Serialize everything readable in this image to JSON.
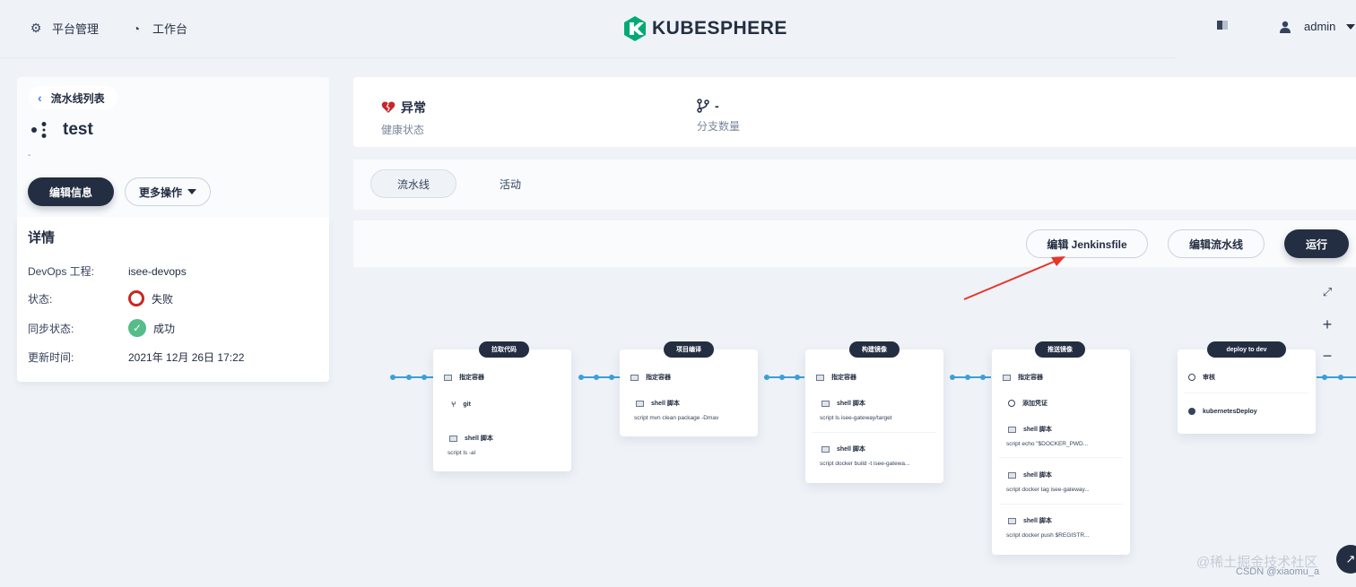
{
  "topbar": {
    "platform_label": "平台管理",
    "workbench_label": "工作台",
    "logo_text": "KUBESPHERE",
    "user": "admin",
    "icons": [
      "gear-icon",
      "dashboard-icon",
      "notebook-icon",
      "user-icon",
      "caret-down-icon"
    ]
  },
  "sidebar": {
    "back_label": "流水线列表",
    "pipeline_name": "test",
    "description": "-",
    "edit_info_label": "编辑信息",
    "more_actions_label": "更多操作",
    "details_title": "详情",
    "details": [
      {
        "label": "DevOps 工程:",
        "value": "isee-devops"
      },
      {
        "label": "状态:",
        "value": "失败"
      },
      {
        "label": "同步状态:",
        "value": "成功"
      },
      {
        "label": "更新时间:",
        "value": "2021年 12月 26日 17:22"
      }
    ]
  },
  "status": {
    "health_value": "异常",
    "health_label": "健康状态",
    "branch_value": "-",
    "branch_label": "分支数量"
  },
  "tabs": [
    {
      "label": "流水线",
      "active": true
    },
    {
      "label": "活动",
      "active": false
    }
  ],
  "toolbar": {
    "edit_jenkinsfile_label": "编辑 Jenkinsfile",
    "edit_pipeline_label": "编辑流水线",
    "run_label": "运行"
  },
  "canvas": {
    "zoom_in": "+",
    "zoom_out": "−",
    "fullscreen_icon": "expand-icon"
  },
  "stages": [
    {
      "name": "拉取代码",
      "steps": [
        {
          "title": "指定容器",
          "icon": "container-icon"
        },
        {
          "title": "git",
          "icon": "git-branch-icon"
        },
        {
          "title": "shell 脚本",
          "icon": "container-icon",
          "sub": "script   ls -al"
        }
      ]
    },
    {
      "name": "项目编译",
      "steps": [
        {
          "title": "指定容器",
          "icon": "container-icon"
        },
        {
          "title": "shell 脚本",
          "icon": "container-icon",
          "sub": "script   mvn clean package -Dmav"
        }
      ]
    },
    {
      "name": "构建镜像",
      "steps": [
        {
          "title": "指定容器",
          "icon": "container-icon"
        },
        {
          "title": "shell 脚本",
          "icon": "container-icon",
          "sub": "script   ls isee-gateway/target"
        },
        {
          "title": "shell 脚本",
          "icon": "container-icon",
          "sub": "script   docker build -t isee-gatewa..."
        }
      ]
    },
    {
      "name": "推送镜像",
      "steps": [
        {
          "title": "指定容器",
          "icon": "container-icon"
        },
        {
          "title": "添加凭证",
          "icon": "key-icon"
        },
        {
          "title": "shell 脚本",
          "icon": "container-icon",
          "sub": "script   echo \"$DOCKER_PWD..."
        },
        {
          "title": "shell 脚本",
          "icon": "container-icon",
          "sub": "script   docker tag isee-gateway..."
        },
        {
          "title": "shell 脚本",
          "icon": "container-icon",
          "sub": "script   docker push $REGISTR..."
        }
      ]
    },
    {
      "name": "deploy to dev",
      "steps": [
        {
          "title": "审核",
          "icon": "review-icon"
        },
        {
          "title": "kubernetesDeploy",
          "icon": "kubernetes-icon"
        }
      ]
    }
  ],
  "watermark": {
    "line1": "@稀土掘金技术社区",
    "line2": "CSDN @xiaomu_a"
  },
  "colors": {
    "dark": "#242e42",
    "connector": "#3aa0d8",
    "failed": "#ca2621",
    "success": "#55bc8a",
    "annotation_arrow": "#e8352a"
  }
}
